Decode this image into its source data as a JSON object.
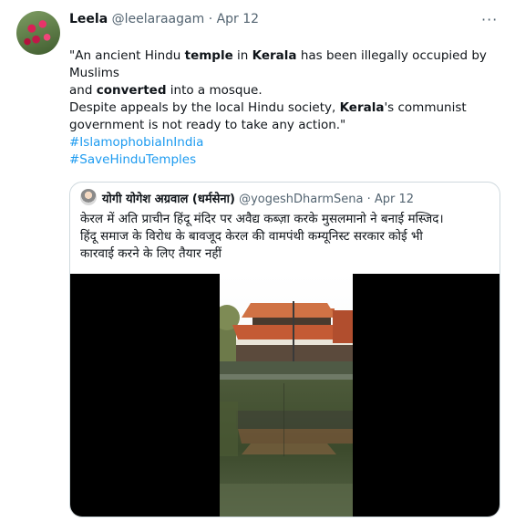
{
  "author": {
    "display_name": "Leela",
    "handle": "@leelaraagam",
    "separator": "·",
    "date": "Apr 12"
  },
  "more_menu": "···",
  "tweet": {
    "line1": [
      {
        "t": "\"An ancient Hindu ",
        "b": false
      },
      {
        "t": "temple",
        "b": true
      },
      {
        "t": " in ",
        "b": false
      },
      {
        "t": "Kerala",
        "b": true
      },
      {
        "t": " has been illegally occupied by Muslims",
        "b": false
      }
    ],
    "line2": [
      {
        "t": "and ",
        "b": false
      },
      {
        "t": "converted",
        "b": true
      },
      {
        "t": " into a mosque.",
        "b": false
      }
    ],
    "line3": [
      {
        "t": "Despite appeals by the local Hindu society, ",
        "b": false
      },
      {
        "t": "Kerala",
        "b": true
      },
      {
        "t": "'s communist",
        "b": false
      }
    ],
    "line4": [
      {
        "t": "government is not ready to take any action.\"",
        "b": false
      }
    ],
    "hashtags": [
      "#IslamophobiaInIndia",
      "#SaveHinduTemples"
    ]
  },
  "quoted_tweet": {
    "display_name": "योगी योगेश अग्रवाल (धर्मसेना)",
    "handle": "@yogeshDharmSena",
    "separator": "·",
    "date": "Apr 12",
    "text_lines": [
      "केरल में अति प्राचीन हिंदू मंदिर पर अवैद्य कब्ज़ा करके मुसलमानो ने बनाई मस्जिद।",
      "हिंदू समाज के विरोध के बावजूद केरल की वामपंथी कम्यूनिस्ट सरकार कोई भी",
      "कारवाई करने के लिए तैयार नहीं"
    ]
  },
  "colors": {
    "link": "#1d9bf0",
    "secondary_text": "#536471",
    "border": "#cfd9de"
  }
}
